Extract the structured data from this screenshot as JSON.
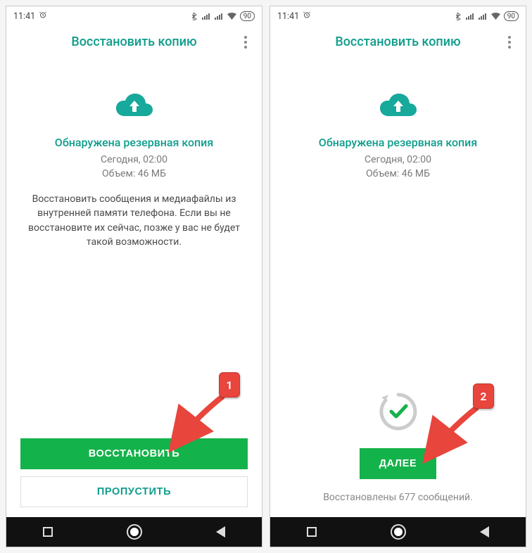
{
  "statusbar": {
    "time": "11:41",
    "battery": "90"
  },
  "screen1": {
    "title": "Восстановить копию",
    "headline": "Обнаружена резервная копия",
    "meta_line1": "Сегодня, 02:00",
    "meta_line2": "Объем: 46 МБ",
    "description": "Восстановить сообщения и медиафайлы из внутренней памяти телефона. Если вы не восстановите их сейчас, позже у вас не будет такой возможности.",
    "primary_btn": "ВОССТАНОВИТЬ",
    "secondary_btn": "ПРОПУСТИТЬ",
    "callout_num": "1"
  },
  "screen2": {
    "title": "Восстановить копию",
    "headline": "Обнаружена резервная копия",
    "meta_line1": "Сегодня, 02:00",
    "meta_line2": "Объем: 46 МБ",
    "primary_btn": "ДАЛЕЕ",
    "restored_text": "Восстановлены 677 сообщений.",
    "callout_num": "2"
  }
}
